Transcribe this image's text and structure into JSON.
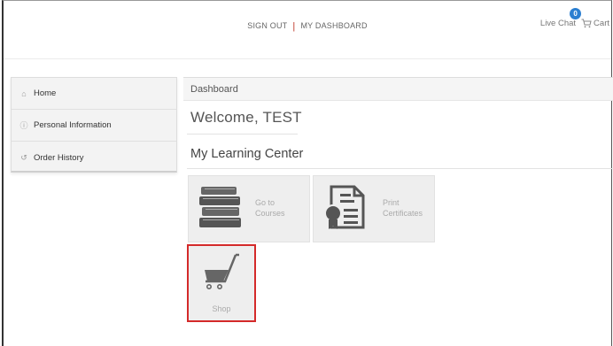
{
  "header": {
    "sign_out": "SIGN OUT",
    "separator": "|",
    "dashboard": "MY DASHBOARD",
    "live_chat": "Live Chat",
    "cart_label": "Cart",
    "cart_count": "0"
  },
  "sidebar": {
    "items": [
      {
        "label": "Home",
        "icon": "home-icon"
      },
      {
        "label": "Personal Information",
        "icon": "info-icon"
      },
      {
        "label": "Order History",
        "icon": "history-icon"
      }
    ]
  },
  "main": {
    "panel_title": "Dashboard",
    "welcome": "Welcome, TEST",
    "section_title": "My Learning Center",
    "tiles": [
      {
        "line1": "Go to",
        "line2": "Courses",
        "icon": "books-icon"
      },
      {
        "line1": "Print",
        "line2": "Certificates",
        "icon": "certificate-icon"
      },
      {
        "line1": "Shop",
        "icon": "cart-icon"
      }
    ]
  },
  "colors": {
    "highlight_border": "#d42a2a",
    "cart_badge": "#2b7fd1",
    "separator": "#c0392b"
  }
}
